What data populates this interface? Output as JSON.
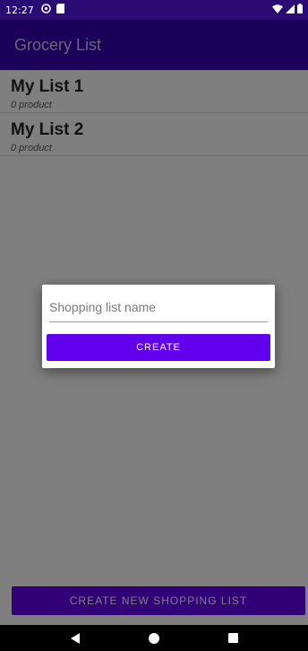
{
  "status_bar": {
    "time": "12:27",
    "icons": [
      "data-saver-icon",
      "sd-card-icon",
      "wifi-icon",
      "signal-icon",
      "battery-icon"
    ]
  },
  "app_bar": {
    "title": "Grocery List"
  },
  "lists": [
    {
      "name": "My List 1",
      "count": "0 product"
    },
    {
      "name": "My List 2",
      "count": "0 product"
    }
  ],
  "bottom_button": {
    "label": "CREATE NEW SHOPPING LIST"
  },
  "dialog": {
    "input_placeholder": "Shopping list name",
    "input_value": "",
    "create_label": "CREATE"
  },
  "nav_bar": {
    "icons": [
      "back-icon",
      "home-icon",
      "recents-icon"
    ]
  },
  "colors": {
    "status_bar": "#2a0a73",
    "app_bar": "#3700b3",
    "accent": "#6200ee",
    "scrim": "rgba(0,0,0,0.5)"
  }
}
